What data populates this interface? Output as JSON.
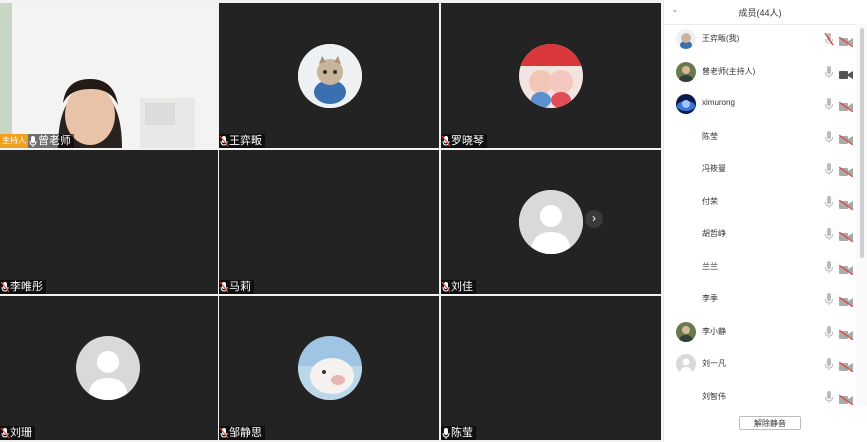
{
  "panel": {
    "title": "成员(44人)",
    "unmute_all_label": "解除静音",
    "members": [
      {
        "name": "王弈畈(我)",
        "avatar": "cartoon-cat",
        "mic": "muted",
        "camera": "off"
      },
      {
        "name": "曾老师(主持人)",
        "avatar": "photo",
        "mic": "on",
        "camera": "on"
      },
      {
        "name": "ximurong",
        "avatar": "planet",
        "mic": "on",
        "camera": "off"
      },
      {
        "name": "陈莹",
        "avatar": "",
        "mic": "on",
        "camera": "off"
      },
      {
        "name": "冯筱曼",
        "avatar": "",
        "mic": "on",
        "camera": "off"
      },
      {
        "name": "付荣",
        "avatar": "",
        "mic": "on",
        "camera": "off"
      },
      {
        "name": "胡哲峥",
        "avatar": "",
        "mic": "on",
        "camera": "off"
      },
      {
        "name": "兰兰",
        "avatar": "",
        "mic": "on",
        "camera": "off"
      },
      {
        "name": "李季",
        "avatar": "",
        "mic": "on",
        "camera": "off"
      },
      {
        "name": "李小静",
        "avatar": "photo",
        "mic": "on",
        "camera": "off"
      },
      {
        "name": "刘一凡",
        "avatar": "default",
        "mic": "on",
        "camera": "off"
      },
      {
        "name": "刘智伟",
        "avatar": "",
        "mic": "on",
        "camera": "off"
      }
    ]
  },
  "tiles": [
    {
      "name": "曾老师",
      "badge": "主持人",
      "type": "video"
    },
    {
      "name": "王弈畈",
      "type": "avatar",
      "avatar": "cartoon-cat"
    },
    {
      "name": "罗晓琴",
      "type": "avatar",
      "avatar": "cartoon-pigs"
    },
    {
      "name": "李唯彤",
      "type": "empty"
    },
    {
      "name": "马莉",
      "type": "empty"
    },
    {
      "name": "刘佳",
      "type": "avatar",
      "avatar": "default"
    },
    {
      "name": "刘珊",
      "type": "avatar",
      "avatar": "default"
    },
    {
      "name": "邹静思",
      "type": "avatar",
      "avatar": "pig-photo"
    },
    {
      "name": "陈莹",
      "type": "empty"
    }
  ],
  "colors": {
    "tile_bg": "#232323",
    "host_badge": "#f0a020",
    "muted_red": "#e04040"
  }
}
